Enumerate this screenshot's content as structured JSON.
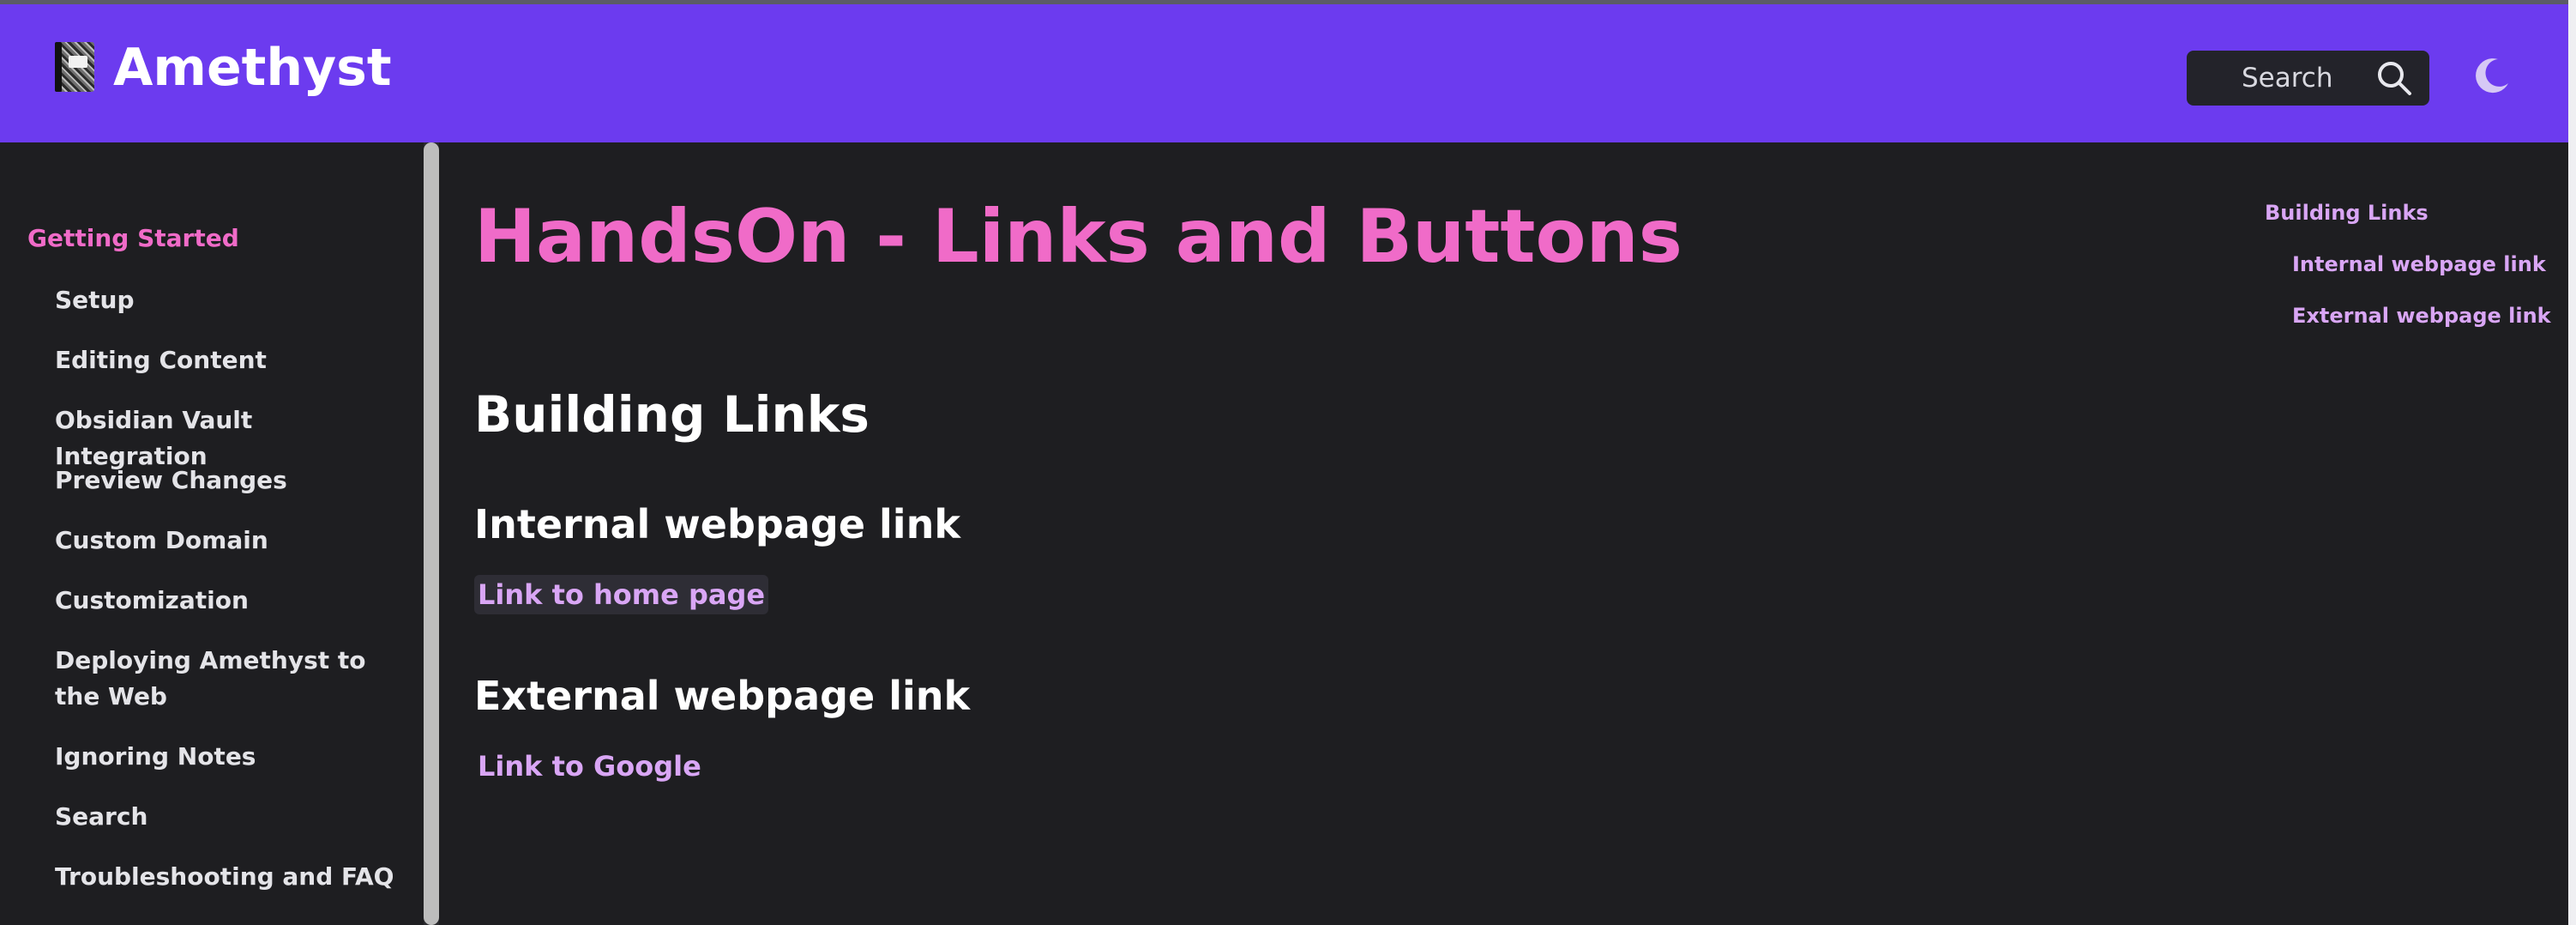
{
  "header": {
    "site_title": "Amethyst",
    "search_label": "Search",
    "logo_icon": "notebook-icon",
    "search_icon": "search-icon",
    "theme_icon": "moon-icon"
  },
  "sidebar": {
    "heading": "Getting Started",
    "items": [
      {
        "label": "Setup"
      },
      {
        "label": "Editing Content"
      },
      {
        "label": "Obsidian Vault Integration"
      },
      {
        "label": "Preview Changes"
      },
      {
        "label": "Custom Domain"
      },
      {
        "label": "Customization"
      },
      {
        "label": "Deploying Amethyst to the Web"
      },
      {
        "label": "Ignoring Notes"
      },
      {
        "label": "Search"
      },
      {
        "label": "Troubleshooting and FAQ"
      }
    ]
  },
  "main": {
    "title": "HandsOn - Links and Buttons",
    "section_heading": "Building Links",
    "internal_heading": "Internal webpage link",
    "internal_link": "Link to home page",
    "external_heading": "External webpage link",
    "external_link": "Link to Google"
  },
  "toc": {
    "items": [
      {
        "label": "Building Links"
      },
      {
        "label": "Internal webpage link"
      },
      {
        "label": "External webpage link"
      }
    ]
  },
  "colors": {
    "header_bg": "#6c3bef",
    "page_bg": "#1e1e21",
    "accent_pink": "#f06bc8",
    "link_purple": "#d9a6f5"
  }
}
